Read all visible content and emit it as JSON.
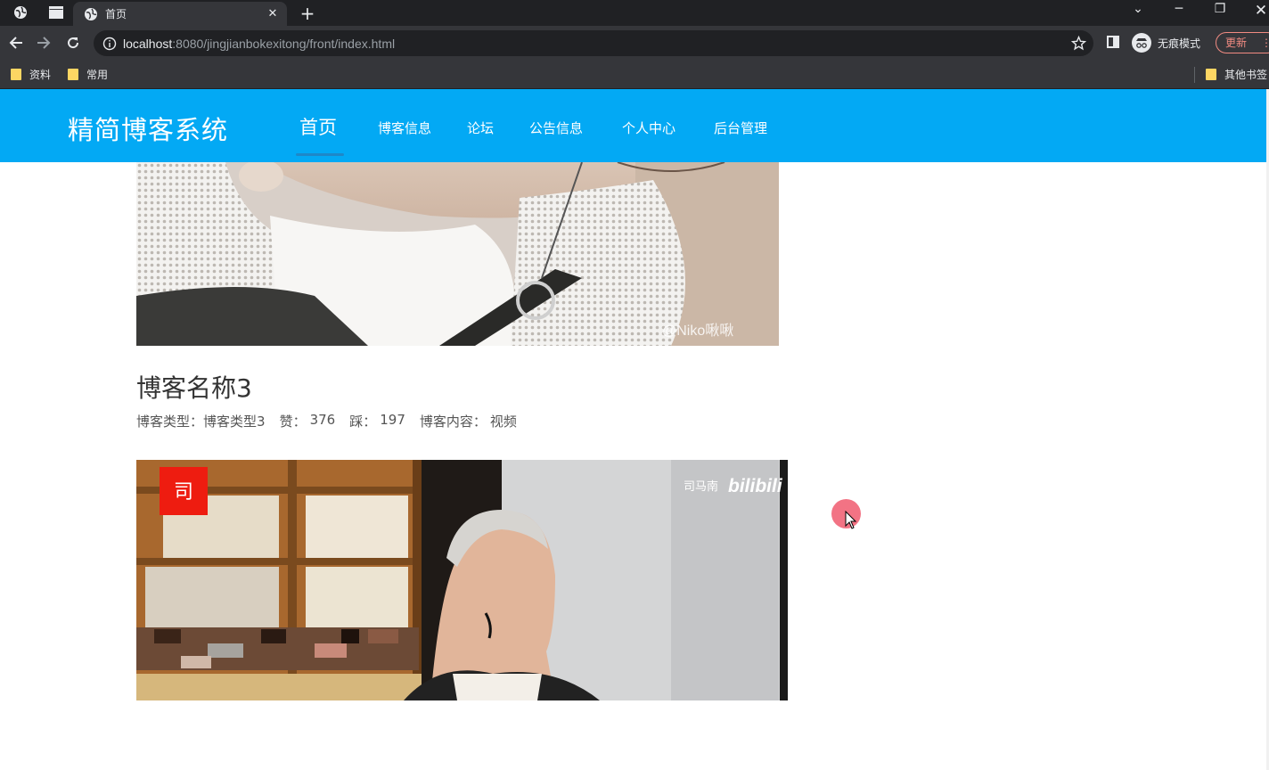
{
  "browser": {
    "tab_title": "首页",
    "url_host": "localhost",
    "url_rest": ":8080/jingjianbokexitong/front/index.html",
    "incognito_label": "无痕模式",
    "update_label": "更新",
    "bookmarks": [
      "资料",
      "常用"
    ],
    "other_bookmarks": "其他书签",
    "icons": [
      "globe-icon",
      "window-icon",
      "close-icon",
      "new-tab-icon",
      "back-icon",
      "forward-icon",
      "reload-icon",
      "info-icon",
      "star-icon",
      "side-panel-icon",
      "incognito-icon",
      "menu-icon",
      "folder-icon"
    ]
  },
  "site": {
    "title": "精简博客系统",
    "nav": [
      "首页",
      "博客信息",
      "论坛",
      "公告信息",
      "个人中心",
      "后台管理"
    ],
    "active_nav": "首页",
    "accent_color": "#03a9f4"
  },
  "blog": {
    "name": "博客名称3",
    "type_label": "博客类型：",
    "type_value": "博客类型3",
    "like_label": "赞：",
    "like_value": "376",
    "dislike_label": "踩：",
    "dislike_value": "197",
    "content_label": "博客内容：",
    "content_value": "视频"
  },
  "media": {
    "image1_watermark": "@Niko啾啾",
    "video_channel": "司马南",
    "video_site": "bilibili",
    "video_logo_char": "司"
  }
}
